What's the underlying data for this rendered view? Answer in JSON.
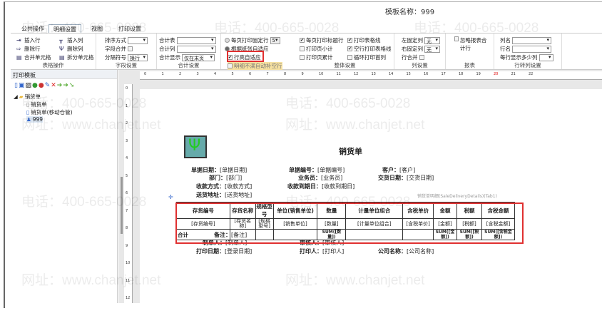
{
  "window": {
    "title": "模板名称：999"
  },
  "watermark": {
    "phone": "电话：400-665-0028",
    "site": "网址：www.chanjet.net"
  },
  "tabs": [
    "公共操作",
    "明细设置",
    "视图",
    "打印设置"
  ],
  "ribbon": {
    "table_ops": {
      "label": "表格操作",
      "items": [
        "插入行",
        "插入列",
        "删除行",
        "删除列",
        "合并单元格",
        "拆分单元格"
      ]
    },
    "field_settings": {
      "label": "字段设置",
      "sort": "排序方式",
      "merge": "字段合并",
      "separator": "分隔符号",
      "separator_value": "换行"
    },
    "total_settings": {
      "label": "合计设置",
      "table": "合计表",
      "column": "合计列",
      "display": "合计显示",
      "display_value": "仅在末页"
    },
    "row_settings": {
      "fixed": "每页打印固定行",
      "fixed_value": "5",
      "adapt": "根据纸张自适应",
      "row_height": "行高自适应",
      "no_empty": "明细不满自动补空行"
    },
    "overall": {
      "label": "整体设置",
      "items": [
        "每页打印标题行",
        "打印页小计",
        "打印页累计",
        "打印表格线",
        "空行打印表格线",
        "循环打印首列"
      ]
    },
    "columns": {
      "label": "列设置",
      "left_fixed": "左固定列",
      "right_fixed": "右固定列",
      "left_value": "无",
      "right_value": "无",
      "row_merge": "行合并"
    },
    "report": {
      "label": "报表",
      "ignore": "忽略报表合计行"
    },
    "row_to_col": {
      "label": "行转列设置",
      "col_name": "列名",
      "row_name": "行名",
      "per_row": "每行显示多少列"
    }
  },
  "left_panel": {
    "title": "打印模板",
    "tree": {
      "root": "销货单",
      "children": [
        "销货单",
        "销货单(移动仓管)",
        "999"
      ]
    }
  },
  "report": {
    "title": "销货单",
    "fields": [
      [
        "单据日期：",
        "[单据日期]"
      ],
      [
        "单据编号：",
        "[单据编号]"
      ],
      [
        "客户：",
        "[客户]"
      ],
      [
        "部门：",
        "[部门]"
      ],
      [
        "业务员：",
        "[业务员]"
      ],
      [
        "交货日期：",
        "[交货日期]"
      ],
      [
        "收款方式：",
        "[收款方式]"
      ],
      [
        "收款到期日：",
        "[收款到期日]"
      ],
      [
        "送货地址：",
        "[送货地址]"
      ]
    ],
    "detail_caption": "销货单明细(SaleDeliveryDetails)(Tab1)",
    "headers": [
      "存货编号",
      "存货名称",
      "规格型号",
      "单位(销售单位)",
      "数量",
      "计量单位组合",
      "含税单价",
      "金额",
      "税额",
      "含税金额"
    ],
    "row": [
      "[存货编号]",
      "[存货名称]",
      "[规格型号]",
      "[销售单位]",
      "[数量]",
      "[计量单位组合]",
      "[含税单价]",
      "[金额]",
      "[税额]",
      "[含税金额]"
    ],
    "total": [
      "合计",
      "",
      "",
      "",
      "SUM([数量])",
      "",
      "",
      "SUM([金额])",
      "SUM([税额])",
      "SUM([含税金额])"
    ],
    "footer": [
      [
        "备注：",
        "[备注]"
      ],
      [
        "制单人：",
        "[制单人]"
      ],
      [
        "审核人：",
        "[审核人]"
      ],
      [
        "打印日期：",
        "[登录日期]"
      ],
      [
        "打印人：",
        "[打印人]"
      ],
      [
        "公司名称：",
        "[公司名称]"
      ]
    ]
  }
}
